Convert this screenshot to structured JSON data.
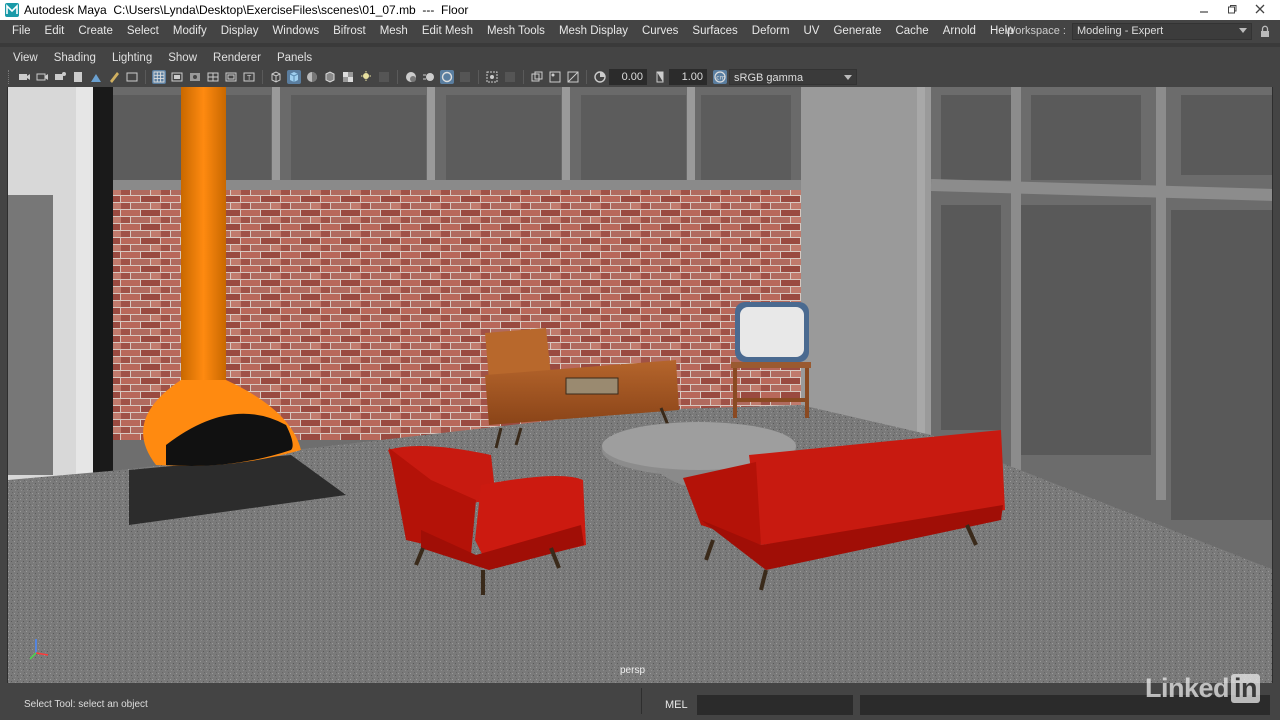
{
  "window": {
    "title": "Autodesk Maya  C:\\Users\\Lynda\\Desktop\\ExerciseFiles\\scenes\\01_07.mb  ---  Floor",
    "controls": [
      "minimize",
      "maximize",
      "close"
    ]
  },
  "menubar": {
    "items": [
      "File",
      "Edit",
      "Create",
      "Select",
      "Modify",
      "Display",
      "Windows",
      "Bifrost",
      "Mesh",
      "Edit Mesh",
      "Mesh Tools",
      "Mesh Display",
      "Curves",
      "Surfaces",
      "Deform",
      "UV",
      "Generate",
      "Cache",
      "Arnold",
      "Help"
    ],
    "workspace_label": "Workspace :",
    "workspace_value": "Modeling - Expert"
  },
  "panel_menu": {
    "items": [
      "View",
      "Shading",
      "Lighting",
      "Show",
      "Renderer",
      "Panels"
    ]
  },
  "toolbar": {
    "exposure_value": "0.00",
    "gamma_value": "1.00",
    "color_space": "sRGB gamma"
  },
  "viewport": {
    "camera_label": "persp"
  },
  "status": {
    "help_text": "Select Tool: select an object",
    "mel_label": "MEL"
  },
  "watermark": {
    "text_left": "Linked",
    "text_box": "in"
  }
}
